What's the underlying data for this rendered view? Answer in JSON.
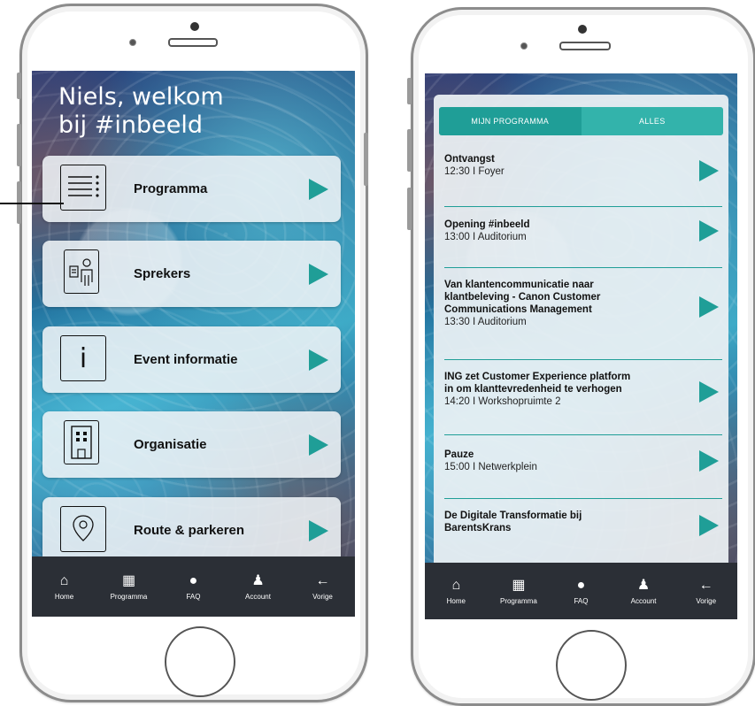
{
  "left_phone": {
    "welcome": "Niels, welkom\nbij #inbeeld",
    "menu": [
      {
        "label": "Programma",
        "icon": "list-icon"
      },
      {
        "label": "Sprekers",
        "icon": "speaker-person-icon"
      },
      {
        "label": "Event informatie",
        "icon": "info-icon"
      },
      {
        "label": "Organisatie",
        "icon": "building-icon"
      },
      {
        "label": "Route & parkeren",
        "icon": "location-pin-icon"
      }
    ]
  },
  "tabbar": [
    {
      "label": "Home",
      "icon": "home-icon"
    },
    {
      "label": "Programma",
      "icon": "calendar-icon"
    },
    {
      "label": "FAQ",
      "icon": "help-icon"
    },
    {
      "label": "Account",
      "icon": "user-icon"
    },
    {
      "label": "Vorige",
      "icon": "back-arrow-icon"
    }
  ],
  "right_phone": {
    "segment": {
      "active": "MIJN PROGRAMMA",
      "other": "ALLES"
    },
    "sessions": [
      {
        "title": "Ontvangst",
        "meta": "12:30 I Foyer"
      },
      {
        "title": "Opening #inbeeld",
        "meta": "13:00 I Auditorium"
      },
      {
        "title": "Van klantencommunicatie naar\nklantbeleving - Canon Customer\nCommunications Management",
        "meta": "13:30 I Auditorium"
      },
      {
        "title": "ING zet Customer Experience platform\nin om klanttevredenheid te verhogen",
        "meta": "14:20 I Workshopruimte 2"
      },
      {
        "title": "Pauze",
        "meta": "15:00 I Netwerkplein"
      },
      {
        "title": "De Digitale Transformatie bij\nBarentsKrans",
        "meta": ""
      }
    ]
  },
  "colors": {
    "accent": "#1f9e97",
    "tabbar": "#2b2f36"
  }
}
